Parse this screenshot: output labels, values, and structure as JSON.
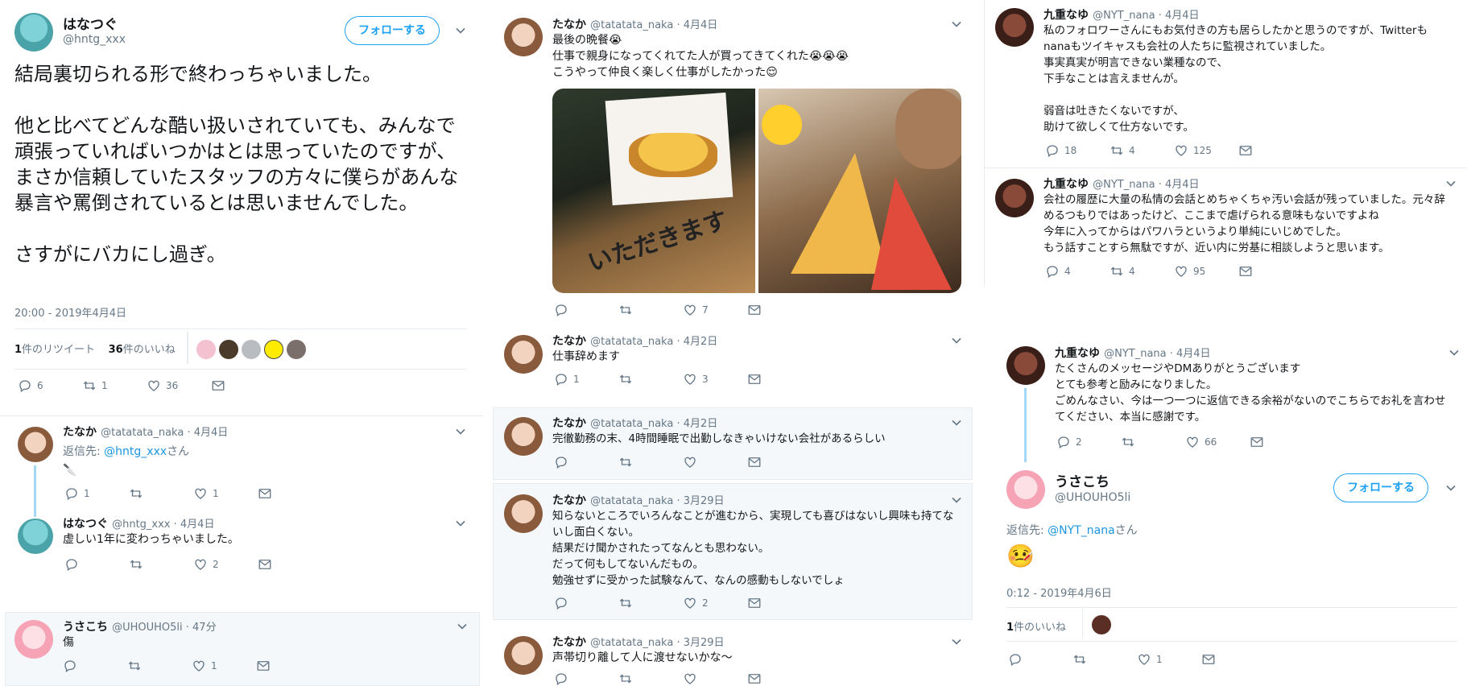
{
  "colors": {
    "accent": "#1da1f2",
    "muted": "#657786",
    "text": "#14171a",
    "thread": "#a5d8f8"
  },
  "icons": {
    "reply": "reply-icon",
    "retweet": "retweet-icon",
    "like": "heart-icon",
    "dm": "mail-icon",
    "more": "chevron-down-icon"
  },
  "main_tweet": {
    "name": "はなつぐ",
    "handle": "@hntg_xxx",
    "follow_label": "フォローする",
    "body": "結局裏切られる形で終わっちゃいました。\n\n他と比べてどんな酷い扱いされていても、みんなで頑張っていればいつかはとは思っていたのですが、まさか信頼していたスタッフの方々に僕らがあんな暴言や罵倒されているとは思いませんでした。\n\nさすがにバカにし過ぎ。",
    "timestamp": "20:00 - 2019年4月4日",
    "rt_count": "1",
    "rt_label": "件のリツイート",
    "like_count": "36",
    "like_label": "件のいいね",
    "action_reply": "6",
    "action_rt": "1",
    "action_like": "36"
  },
  "col1_replies": [
    {
      "name": "たなか",
      "meta": "@tatatata_naka · 4月4日",
      "reply_prefix": "返信先: ",
      "reply_to": "@hntg_xxx",
      "reply_suffix": "さん",
      "body": "🔪",
      "reply": "1",
      "rt": "",
      "like": "1"
    },
    {
      "name": "はなつぐ",
      "meta": "@hntg_xxx · 4月4日",
      "body": "虚しい1年に変わっちゃいました。",
      "reply": "",
      "rt": "",
      "like": "2"
    },
    {
      "name": "うさこち",
      "meta": "@UHOUHO5li · 47分",
      "body": "傷",
      "reply": "",
      "rt": "",
      "like": "1"
    }
  ],
  "col2_tweets": [
    {
      "name": "たなか",
      "meta": "@tatatata_naka · 4月4日",
      "body": "最後の晩餐😭\n仕事で親身になってくれてた人が買ってきてくれた😭😭😭\nこうやって仲良く楽しく仕事がしたかった😌",
      "reply": "",
      "rt": "",
      "like": "7",
      "img_text": "いただきます"
    },
    {
      "name": "たなか",
      "meta": "@tatatata_naka · 4月2日",
      "body": "仕事辞めます",
      "reply": "1",
      "rt": "",
      "like": "3"
    },
    {
      "name": "たなか",
      "meta": "@tatatata_naka · 4月2日",
      "body": "完徹勤務の末、4時間睡眠で出勤しなきゃいけない会社があるらしい",
      "reply": "",
      "rt": "",
      "like": ""
    },
    {
      "name": "たなか",
      "meta": "@tatatata_naka · 3月29日",
      "body": "知らないところでいろんなことが進むから、実現しても喜びはないし興味も持てないし面白くない。\n結果だけ聞かされたってなんとも思わない。\nだって何もしてないんだもの。\n勉強せずに受かった試験なんて、なんの感動もしないでしょ",
      "reply": "",
      "rt": "",
      "like": "2"
    },
    {
      "name": "たなか",
      "meta": "@tatatata_naka · 3月29日",
      "body": "声帯切り離して人に渡せないかな〜",
      "reply": "",
      "rt": "",
      "like": ""
    }
  ],
  "col3_tweets": [
    {
      "name": "九重なゆ",
      "meta": "@NYT_nana · 4月4日",
      "body": "私のフォロワーさんにもお気付きの方も居らしたかと思うのですが、Twitterもnanaもツイキャスも会社の人たちに監視されていました。\n事実真実が明言できない業種なので、\n下手なことは言えませんが。\n\n弱音は吐きたくないですが、\n助けて欲しくて仕方ないです。",
      "reply": "18",
      "rt": "4",
      "like": "125"
    },
    {
      "name": "九重なゆ",
      "meta": "@NYT_nana · 4月4日",
      "body": "会社の履歴に大量の私情の会話とめちゃくちゃ汚い会話が残っていました。元々辞めるつもりではあったけど、ここまで虐げられる意味もないですよね\n今年に入ってからはパワハラというより単純にいじめでした。\nもう話すことすら無駄ですが、近い内に労基に相談しようと思います。",
      "reply": "4",
      "rt": "4",
      "like": "95"
    },
    {
      "name": "九重なゆ",
      "meta": "@NYT_nana · 4月4日",
      "body": "たくさんのメッセージやDMありがとうございます\nとても参考と励みになりました。\nごめんなさい、今は一つ一つに返信できる余裕がないのでこちらでお礼を言わせてください、本当に感謝です。",
      "reply": "2",
      "rt": "",
      "like": "66"
    }
  ],
  "col3_focus": {
    "name": "うさこち",
    "handle": "@UHOUHO5li",
    "follow_label": "フォローする",
    "reply_prefix": "返信先: ",
    "reply_to": "@NYT_nana",
    "reply_suffix": "さん",
    "emoji": "🤒",
    "timestamp": "0:12 - 2019年4月6日",
    "like_count": "1",
    "like_label": "件のいいね",
    "reply": "",
    "rt": "",
    "like": "1"
  }
}
